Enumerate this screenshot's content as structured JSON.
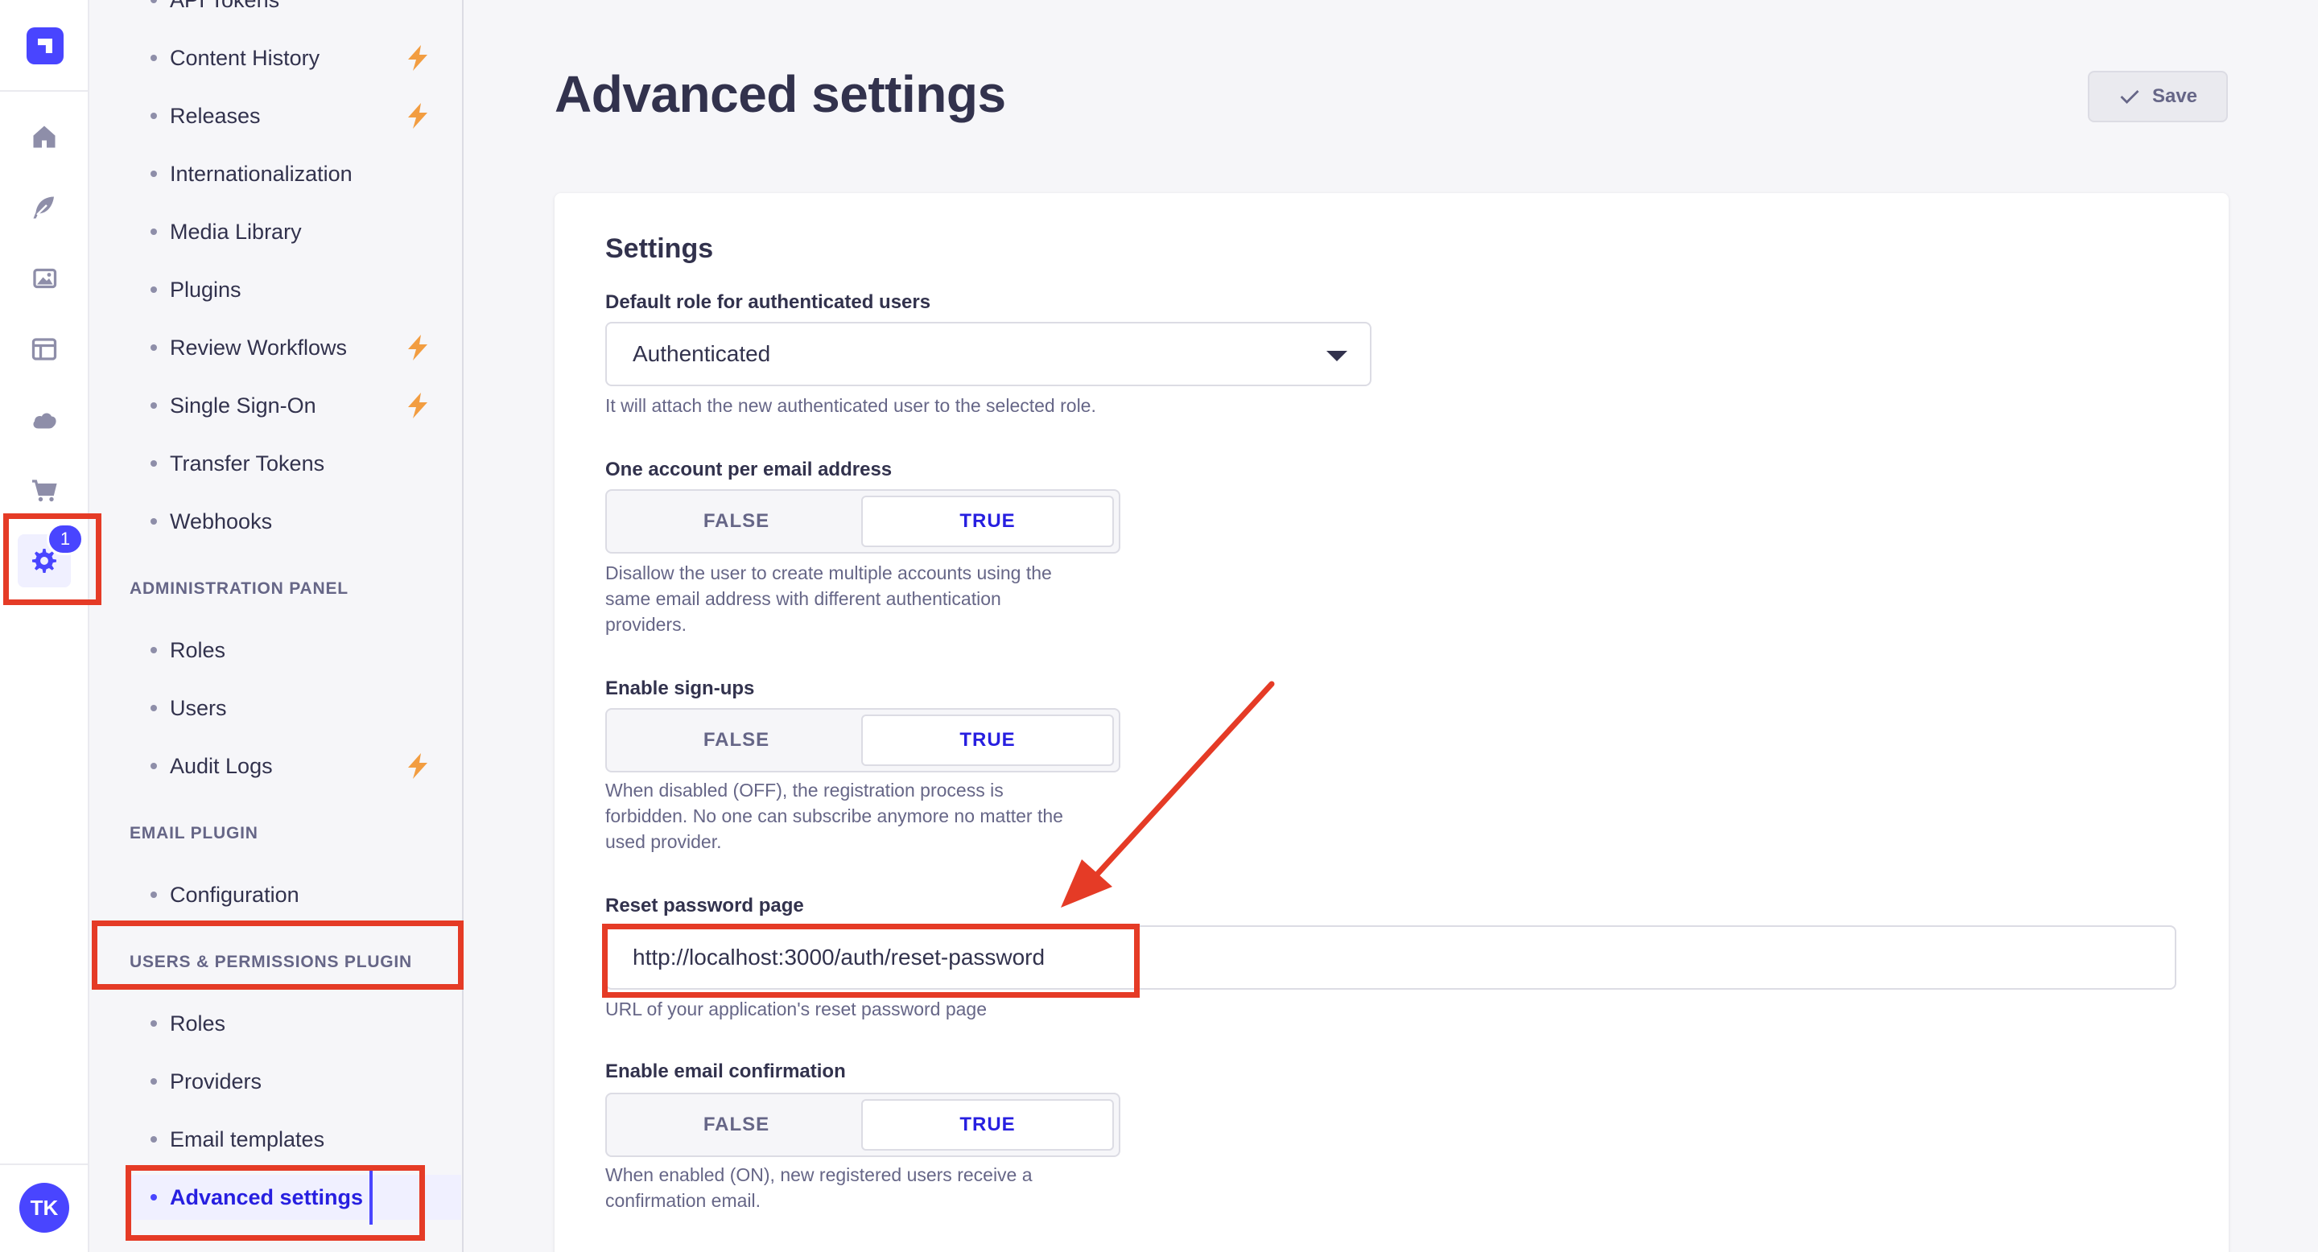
{
  "rail": {
    "badge": "1",
    "avatar": "TK",
    "icons": [
      "logo-icon",
      "home-icon",
      "content-manager-icon",
      "media-icon",
      "layout-icon",
      "cloud-icon",
      "marketplace-icon",
      "settings-icon"
    ]
  },
  "subnav": {
    "items_top": [
      {
        "label": "API Tokens",
        "pro": false
      },
      {
        "label": "Content History",
        "pro": true
      },
      {
        "label": "Releases",
        "pro": true
      },
      {
        "label": "Internationalization",
        "pro": false
      },
      {
        "label": "Media Library",
        "pro": false
      },
      {
        "label": "Plugins",
        "pro": false
      },
      {
        "label": "Review Workflows",
        "pro": true
      },
      {
        "label": "Single Sign-On",
        "pro": true
      },
      {
        "label": "Transfer Tokens",
        "pro": false
      },
      {
        "label": "Webhooks",
        "pro": false
      }
    ],
    "section_admin": "ADMINISTRATION PANEL",
    "items_admin": [
      {
        "label": "Roles",
        "pro": false
      },
      {
        "label": "Users",
        "pro": false
      },
      {
        "label": "Audit Logs",
        "pro": true
      }
    ],
    "section_email": "EMAIL PLUGIN",
    "items_email": [
      {
        "label": "Configuration"
      }
    ],
    "section_users": "USERS & PERMISSIONS PLUGIN",
    "items_users": [
      {
        "label": "Roles"
      },
      {
        "label": "Providers"
      },
      {
        "label": "Email templates"
      },
      {
        "label": "Advanced settings",
        "active": true
      }
    ]
  },
  "page": {
    "title": "Advanced settings",
    "save_label": "Save",
    "card_title": "Settings",
    "default_role": {
      "label": "Default role for authenticated users",
      "value": "Authenticated",
      "hint": "It will attach the new authenticated user to the selected role."
    },
    "one_account": {
      "label": "One account per email address",
      "false_label": "FALSE",
      "true_label": "TRUE",
      "selected": "TRUE",
      "hint_lines": [
        "Disallow the user to create multiple accounts using the",
        "same email address with different authentication",
        "providers."
      ]
    },
    "signups": {
      "label": "Enable sign-ups",
      "false_label": "FALSE",
      "true_label": "TRUE",
      "selected": "TRUE",
      "hint_lines": [
        "When disabled (OFF), the registration process is",
        "forbidden. No one can subscribe anymore no matter the",
        "used provider."
      ]
    },
    "reset_password": {
      "label": "Reset password page",
      "value": "http://localhost:3000/auth/reset-password",
      "hint": "URL of your application's reset password page"
    },
    "email_confirmation": {
      "label": "Enable email confirmation",
      "false_label": "FALSE",
      "true_label": "TRUE",
      "selected": "TRUE",
      "hint_lines": [
        "When enabled (ON), new registered users receive a",
        "confirmation email."
      ]
    }
  },
  "colors": {
    "primary": "#4945ff",
    "annotation": "#e53b26",
    "pro_bolt": "#f29d41"
  }
}
